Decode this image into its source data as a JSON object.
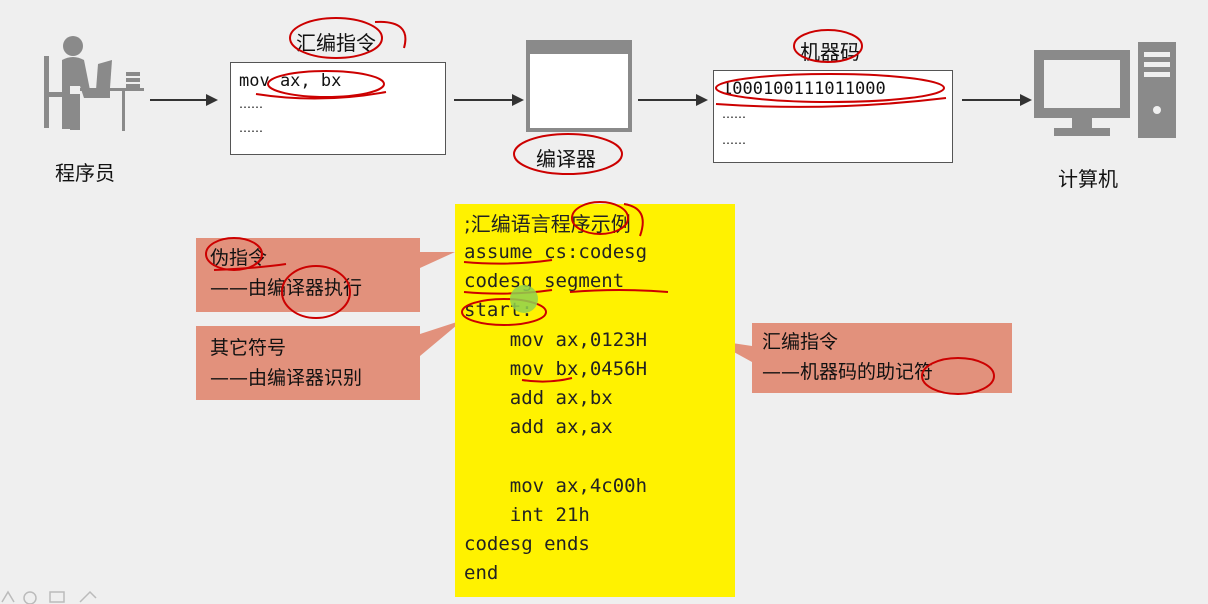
{
  "flow": {
    "programmer_label": "程序员",
    "asm_title": "汇编指令",
    "asm_lines": [
      "mov ax, bx",
      "……",
      "……"
    ],
    "compiler_label": "编译器",
    "machine_title": "机器码",
    "machine_lines": [
      "1000100111011000",
      "……",
      "……"
    ],
    "computer_label": "计算机"
  },
  "code": {
    "lines": [
      ";汇编语言程序示例",
      "assume cs:codesg",
      "codesg segment",
      "start:",
      "    mov ax,0123H",
      "    mov bx,0456H",
      "    add ax,bx",
      "    add ax,ax",
      "",
      "    mov ax,4c00h",
      "    int 21h",
      "codesg ends",
      "end"
    ]
  },
  "callouts": {
    "pseudo": [
      "伪指令",
      "——由编译器执行"
    ],
    "symbols": [
      "其它符号",
      "——由编译器识别"
    ],
    "mnemonic": [
      "汇编指令",
      "——机器码的助记符"
    ]
  },
  "colors": {
    "callout_fill": "#e2917c",
    "code_bg": "#fff200",
    "annotation": "#cc0000",
    "icon_gray": "#8a8a8a"
  }
}
